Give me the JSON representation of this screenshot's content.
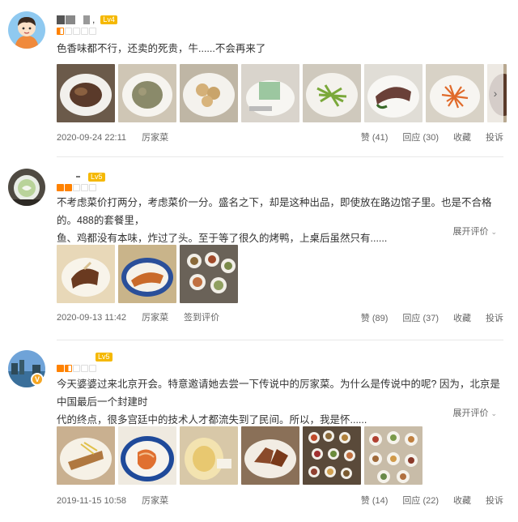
{
  "reviews": [
    {
      "user_name": ",",
      "level": "Lv4",
      "rating_stars": 0.5,
      "text": "色香味都不行，还卖的死贵，牛......不会再来了",
      "date": "2020-09-24 22:11",
      "shop": "厉家菜",
      "tag": "",
      "expand_label": "",
      "actions": {
        "like": "赞",
        "like_count": "(41)",
        "reply": "回应",
        "reply_count": "(30)",
        "collect": "收藏",
        "report": "投诉"
      }
    },
    {
      "user_name": "",
      "level": "Lv5",
      "rating_stars": 2,
      "text_line1": "不考虑菜价打两分，考虑菜价一分。盛名之下，却是这种出品，即使放在路边馆子里。也是不合格的。488的套餐里，",
      "text_line2": "鱼、鸡都没有本味，炸过了头。至于等了很久的烤鸭，上桌后虽然只有......",
      "date": "2020-09-13 11:42",
      "shop": "厉家菜",
      "tag": "签到评价",
      "expand_label": "展开评价",
      "actions": {
        "like": "赞",
        "like_count": "(89)",
        "reply": "回应",
        "reply_count": "(37)",
        "collect": "收藏",
        "report": "投诉"
      }
    },
    {
      "user_name": "",
      "level": "Lv5",
      "rating_stars": 1.5,
      "text_line1": "今天婆婆过来北京开会。特意邀请她去尝一下传说中的厉家菜。为什么是传说中的呢? 因为，北京是中国最后一个封建时",
      "text_line2": "代的终点，很多宫廷中的技术人才都流失到了民间。所以，我是怀......",
      "date": "2019-11-15 10:58",
      "shop": "厉家菜",
      "tag": "",
      "expand_label": "展开评价",
      "vip_badge": "V",
      "actions": {
        "like": "赞",
        "like_count": "(14)",
        "reply": "回应",
        "reply_count": "(22)",
        "collect": "收藏",
        "report": "投诉"
      }
    }
  ],
  "icons": {
    "next_photo": "chevron-right-icon",
    "expand": "chevron-down-icon"
  },
  "colors": {
    "star": "#ff8200",
    "level_badge": "#f5b800",
    "vip": "#f5a623"
  }
}
